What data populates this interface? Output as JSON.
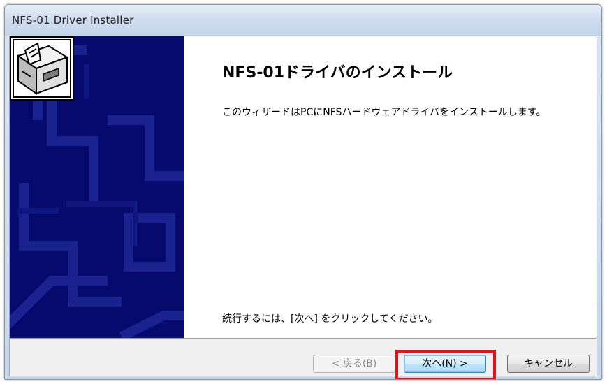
{
  "window": {
    "title": "NFS-01 Driver Installer"
  },
  "wizard": {
    "heading": "NFS-01ドライバのインストール",
    "description": "このウィザードはPCにNFSハードウェアドライバをインストールします。",
    "continue_hint": "続行するには、[次へ] をクリックしてください。",
    "side_panel_color": "#060a6c",
    "icon": "installer-box-icon"
  },
  "buttons": {
    "back_label": "< 戻る(B)",
    "next_label": "次へ(N) >",
    "cancel_label": "キャンセル"
  },
  "annotation": {
    "highlight_color": "#e2121a",
    "highlighted_element": "next-button"
  }
}
